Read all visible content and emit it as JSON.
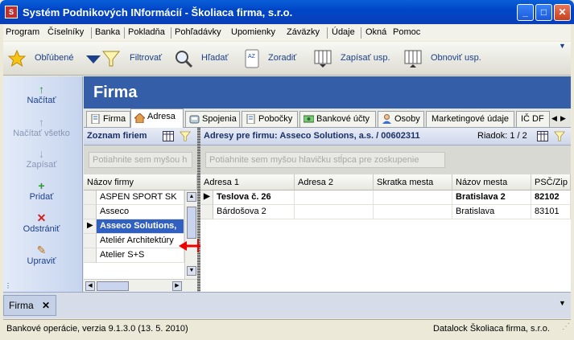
{
  "window": {
    "title": "Systém Podnikových INformácií - Školiaca firma, s.r.o."
  },
  "menu": [
    "Program",
    "Číselníky",
    "Banka",
    "Pokladňa",
    "Pohľadávky",
    "Upomienky",
    "Záväzky",
    "Údaje",
    "Okná",
    "Pomoc"
  ],
  "toolbar": {
    "favorites": "Obľúbené",
    "filter": "Filtrovať",
    "search": "Hľadať",
    "sort": "Zoradiť",
    "sort_icon_text": "AZ",
    "save_usp": "Zapísať usp.",
    "restore_usp": "Obnoviť usp."
  },
  "sidebar": [
    {
      "label": "Načítať",
      "icon": "↑",
      "color": "#2a9a2a",
      "enabled": true
    },
    {
      "label": "Načítať všetko",
      "icon": "↑",
      "color": "#8aa",
      "enabled": false
    },
    {
      "label": "Zapísať",
      "icon": "↓",
      "color": "#8aa",
      "enabled": false
    },
    {
      "label": "Pridať",
      "icon": "+",
      "color": "#2a9a2a",
      "enabled": true
    },
    {
      "label": "Odstrániť",
      "icon": "✕",
      "color": "#d02020",
      "enabled": true
    },
    {
      "label": "Upraviť",
      "icon": "✎",
      "color": "#c07010",
      "enabled": true
    }
  ],
  "page": {
    "title": "Firma"
  },
  "tabs": [
    "Firma",
    "Adresa",
    "Spojenia",
    "Pobočky",
    "Bankové účty",
    "Osoby",
    "Marketingové údaje",
    "IČ DF"
  ],
  "left_panel": {
    "title": "Zoznam firiem",
    "group_placeholder": "Potiahnite sem myšou h",
    "column": "Názov firmy",
    "rows": [
      "ASPEN SPORT SK",
      "Asseco",
      "Asseco Solutions,",
      "Ateliér Architektúry",
      "Atelier S+S"
    ],
    "selected_index": 2
  },
  "right_panel": {
    "title": "Adresy pre firmu: Asseco Solutions, a.s. / 00602311",
    "row_counter": "Riadok: 1 / 2",
    "group_placeholder": "Potiahnite sem myšou hlavičku stĺpca pre zoskupenie",
    "columns": [
      "Adresa 1",
      "Adresa 2",
      "Skratka mesta",
      "Názov mesta",
      "PSČ/Zip"
    ],
    "rows": [
      [
        "Teslova č. 26",
        "",
        "",
        "Bratislava 2",
        "82102"
      ],
      [
        "Bárdošova 2",
        "",
        "",
        "Bratislava",
        "83101"
      ]
    ]
  },
  "bottom": {
    "tab": "Firma"
  },
  "status": {
    "left": "Bankové operácie, verzia 9.1.3.0 (13. 5. 2010)",
    "right": "Datalock  Školiaca firma, s.r.o."
  }
}
